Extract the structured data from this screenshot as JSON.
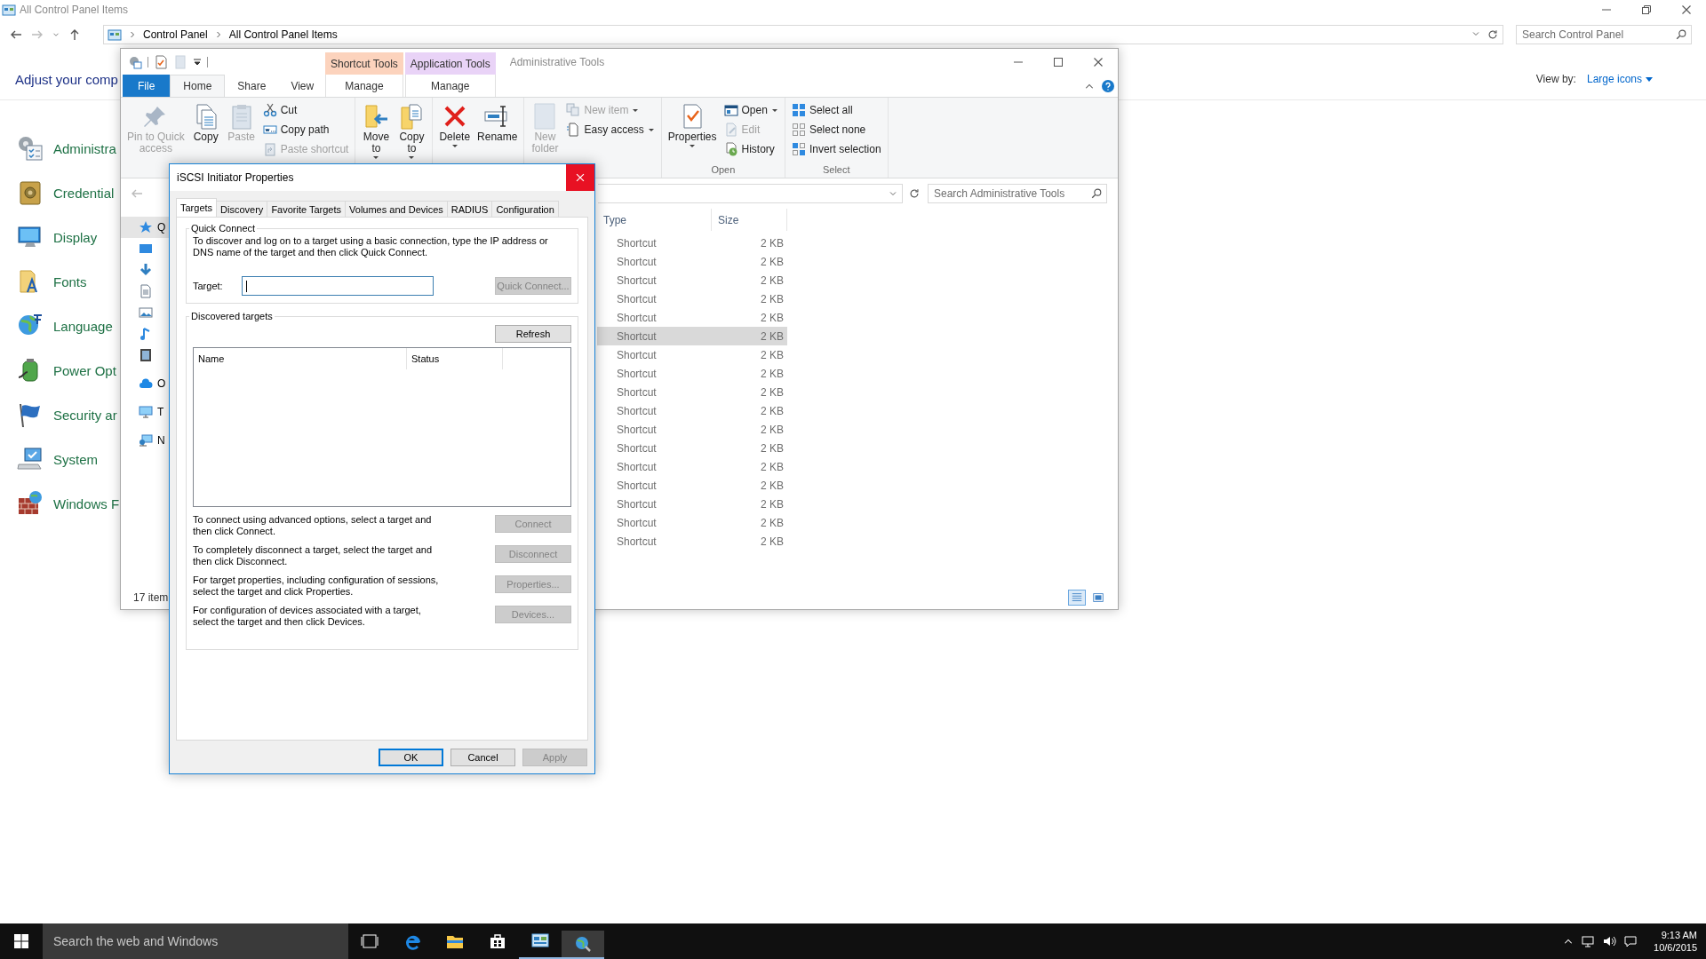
{
  "control_panel": {
    "title": "All Control Panel Items",
    "breadcrumb": [
      "Control Panel",
      "All Control Panel Items"
    ],
    "search": {
      "placeholder": "Search Control Panel"
    },
    "heading": "Adjust your comp",
    "view_by": {
      "label": "View by:",
      "value": "Large icons"
    },
    "items": [
      {
        "label": "Administra"
      },
      {
        "label": "Credential"
      },
      {
        "label": "Display"
      },
      {
        "label": "Fonts"
      },
      {
        "label": "Language"
      },
      {
        "label": "Power Opt"
      },
      {
        "label": "Security ar"
      },
      {
        "label": "System"
      },
      {
        "label": "Windows F"
      }
    ]
  },
  "explorer": {
    "title": "Administrative Tools",
    "context_tabs": [
      {
        "header": "Shortcut Tools",
        "tab": "Manage",
        "color": "#fcd3bd",
        "selected": false
      },
      {
        "header": "Application Tools",
        "tab": "Manage",
        "color": "#e9d3f7",
        "selected": false
      }
    ],
    "ribbon_tabs": [
      {
        "label": "File",
        "kind": "file",
        "selected": false
      },
      {
        "label": "Home",
        "kind": "tab",
        "selected": true
      },
      {
        "label": "Share",
        "kind": "tab",
        "selected": false
      },
      {
        "label": "View",
        "kind": "tab",
        "selected": false
      }
    ],
    "ribbon_groups": [
      {
        "buttons": [
          {
            "label": "Pin to Quick\naccess",
            "kind": "large",
            "disabled": true,
            "dropdown": false
          },
          {
            "label": "Copy",
            "kind": "large",
            "disabled": false,
            "dropdown": false
          },
          {
            "label": "Paste",
            "kind": "large",
            "disabled": true,
            "dropdown": false
          },
          {
            "label": "Cut",
            "kind": "small",
            "disabled": false,
            "dropdown": false
          },
          {
            "label": "Copy path",
            "kind": "small",
            "disabled": false,
            "dropdown": false
          },
          {
            "label": "Paste shortcut",
            "kind": "small",
            "disabled": true,
            "dropdown": false
          }
        ]
      },
      {
        "buttons": [
          {
            "label": "Move\nto",
            "kind": "large",
            "disabled": false,
            "dropdown": true
          },
          {
            "label": "Copy\nto",
            "kind": "large",
            "disabled": false,
            "dropdown": true
          }
        ]
      },
      {
        "buttons": [
          {
            "label": "Delete",
            "kind": "large",
            "disabled": false,
            "dropdown": true
          },
          {
            "label": "Rename",
            "kind": "large",
            "disabled": false,
            "dropdown": false
          }
        ]
      },
      {
        "buttons": [
          {
            "label": "New\nfolder",
            "kind": "large",
            "disabled": true,
            "dropdown": false
          },
          {
            "label": "New item",
            "kind": "small",
            "disabled": true,
            "dropdown": true
          },
          {
            "label": "Easy access",
            "kind": "small",
            "disabled": false,
            "dropdown": true
          }
        ]
      },
      {
        "label": "Open",
        "buttons": [
          {
            "label": "Properties",
            "kind": "large",
            "disabled": false,
            "dropdown": true
          },
          {
            "label": "Open",
            "kind": "small",
            "disabled": false,
            "dropdown": true
          },
          {
            "label": "Edit",
            "kind": "small",
            "disabled": true,
            "dropdown": false
          },
          {
            "label": "History",
            "kind": "small",
            "disabled": false,
            "dropdown": false
          }
        ]
      },
      {
        "label": "Select",
        "buttons": [
          {
            "label": "Select all",
            "kind": "small",
            "disabled": false,
            "dropdown": false
          },
          {
            "label": "Select none",
            "kind": "small",
            "disabled": false,
            "dropdown": false
          },
          {
            "label": "Invert selection",
            "kind": "small",
            "disabled": false,
            "dropdown": false
          }
        ]
      }
    ],
    "search": {
      "placeholder": "Search Administrative Tools"
    },
    "nav_pane": [
      {
        "kind": "quick_access",
        "label": "Q",
        "selected": true
      },
      {
        "kind": "desktop",
        "selected": false
      },
      {
        "kind": "downloads",
        "selected": false
      },
      {
        "kind": "documents",
        "selected": false
      },
      {
        "kind": "pictures",
        "selected": false
      },
      {
        "kind": "music",
        "selected": false
      },
      {
        "kind": "videos",
        "selected": false
      },
      {
        "kind": "onedrive",
        "label": "O",
        "selected": false
      },
      {
        "kind": "this_pc",
        "label": "T",
        "selected": false
      },
      {
        "kind": "network",
        "label": "N",
        "selected": false
      }
    ],
    "columns": [
      "Type",
      "Size"
    ],
    "rows": [
      {
        "type": "Shortcut",
        "size": "2 KB",
        "selected": false
      },
      {
        "type": "Shortcut",
        "size": "2 KB",
        "selected": false
      },
      {
        "type": "Shortcut",
        "size": "2 KB",
        "selected": false
      },
      {
        "type": "Shortcut",
        "size": "2 KB",
        "selected": false
      },
      {
        "type": "Shortcut",
        "size": "2 KB",
        "selected": false
      },
      {
        "type": "Shortcut",
        "size": "2 KB",
        "selected": true
      },
      {
        "type": "Shortcut",
        "size": "2 KB",
        "selected": false
      },
      {
        "type": "Shortcut",
        "size": "2 KB",
        "selected": false
      },
      {
        "type": "Shortcut",
        "size": "2 KB",
        "selected": false
      },
      {
        "type": "Shortcut",
        "size": "2 KB",
        "selected": false
      },
      {
        "type": "Shortcut",
        "size": "2 KB",
        "selected": false
      },
      {
        "type": "Shortcut",
        "size": "2 KB",
        "selected": false
      },
      {
        "type": "Shortcut",
        "size": "2 KB",
        "selected": false
      },
      {
        "type": "Shortcut",
        "size": "2 KB",
        "selected": false
      },
      {
        "type": "Shortcut",
        "size": "2 KB",
        "selected": false
      },
      {
        "type": "Shortcut",
        "size": "2 KB",
        "selected": false
      },
      {
        "type": "Shortcut",
        "size": "2 KB",
        "selected": false
      }
    ],
    "status": "17 item",
    "views": [
      {
        "kind": "details",
        "selected": true
      },
      {
        "kind": "large_icons",
        "selected": false
      }
    ]
  },
  "dialog": {
    "title": "iSCSI Initiator Properties",
    "tabs": [
      {
        "label": "Targets",
        "selected": true
      },
      {
        "label": "Discovery",
        "selected": false
      },
      {
        "label": "Favorite Targets",
        "selected": false
      },
      {
        "label": "Volumes and Devices",
        "selected": false
      },
      {
        "label": "RADIUS",
        "selected": false
      },
      {
        "label": "Configuration",
        "selected": false
      }
    ],
    "quick_connect": {
      "legend": "Quick Connect",
      "text": "To discover and log on to a target using a basic connection, type the IP address or DNS name of the target and then click Quick Connect.",
      "target_label": "Target:",
      "button": {
        "label": "Quick Connect...",
        "disabled": true
      }
    },
    "discovered": {
      "legend": "Discovered targets",
      "refresh": {
        "label": "Refresh",
        "disabled": false
      },
      "columns": [
        "Name",
        "Status"
      ],
      "actions": [
        {
          "text": "To connect using advanced options, select a target and then click Connect.",
          "button": {
            "label": "Connect",
            "disabled": true
          }
        },
        {
          "text": "To completely disconnect a target, select the target and then click Disconnect.",
          "button": {
            "label": "Disconnect",
            "disabled": true
          }
        },
        {
          "text": "For target properties, including configuration of sessions, select the target and click Properties.",
          "button": {
            "label": "Properties...",
            "disabled": true
          }
        },
        {
          "text": "For configuration of devices associated with a target, select the target and then click Devices.",
          "button": {
            "label": "Devices...",
            "disabled": true
          }
        }
      ]
    },
    "buttons": [
      {
        "label": "OK",
        "default": true,
        "disabled": false
      },
      {
        "label": "Cancel",
        "default": false,
        "disabled": false
      },
      {
        "label": "Apply",
        "default": false,
        "disabled": true
      }
    ]
  },
  "taskbar": {
    "search": {
      "placeholder": "Search the web and Windows"
    },
    "apps": [
      {
        "kind": "task_view",
        "running": false,
        "active": false
      },
      {
        "kind": "edge",
        "running": false,
        "active": false
      },
      {
        "kind": "explorer",
        "running": false,
        "active": false
      },
      {
        "kind": "store",
        "running": false,
        "active": false
      },
      {
        "kind": "control_panel",
        "running": true,
        "active": false
      },
      {
        "kind": "iscsi",
        "running": true,
        "active": true
      }
    ],
    "clock": {
      "time": "9:13 AM",
      "date": "10/6/2015"
    }
  }
}
